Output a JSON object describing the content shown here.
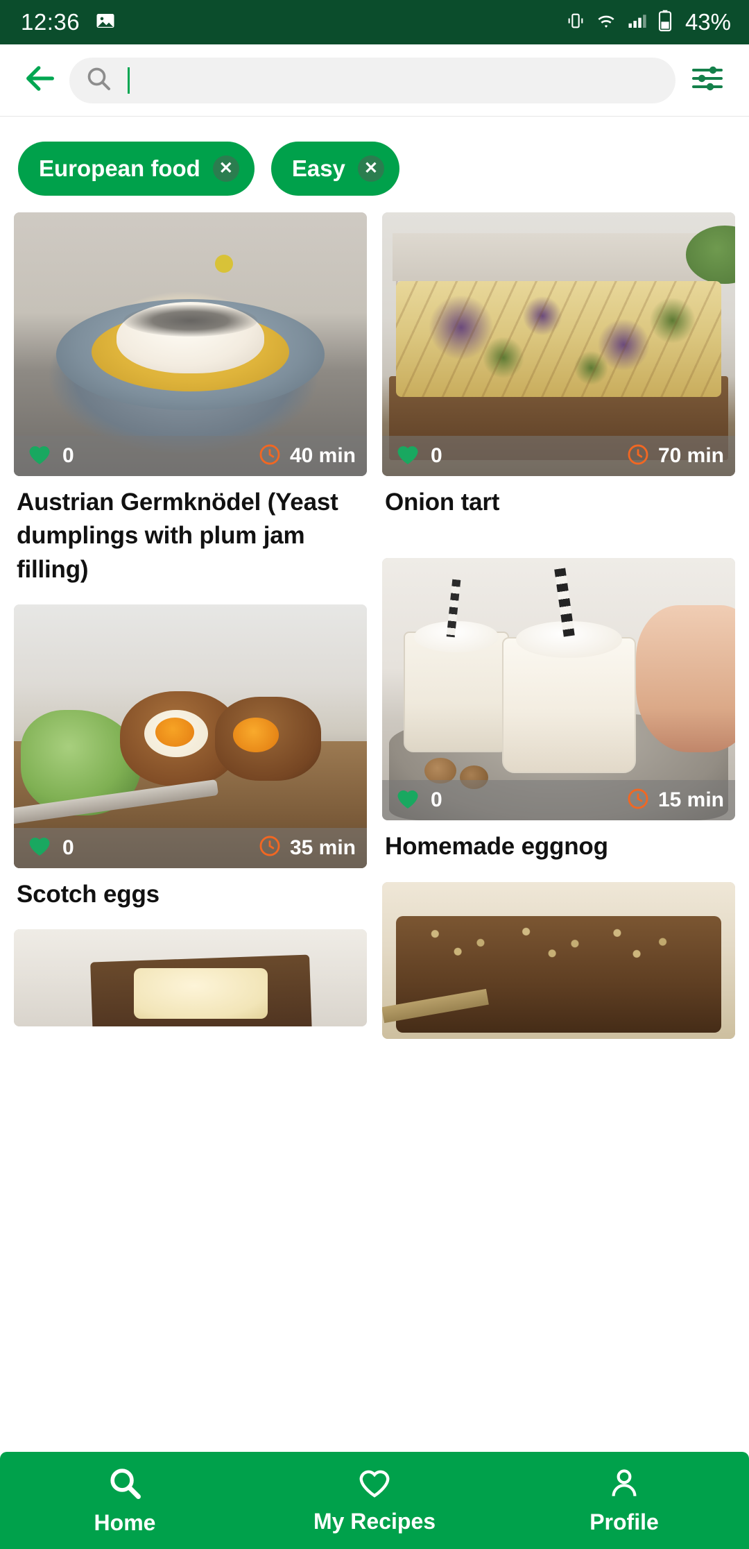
{
  "statusbar": {
    "clock": "12:36",
    "battery": "43%",
    "icons": [
      "image-icon",
      "vibrate-icon",
      "wifi-icon",
      "signal-icon",
      "battery-icon"
    ]
  },
  "search": {
    "back_icon": "arrow-left-icon",
    "search_icon": "search-icon",
    "value": "",
    "placeholder": "",
    "filter_icon": "filter-sliders-icon"
  },
  "filters": [
    {
      "label": "European food",
      "remove_icon": "close-circle-icon"
    },
    {
      "label": "Easy",
      "remove_icon": "close-circle-icon"
    }
  ],
  "colors": {
    "brand_green": "#00a14b",
    "status_bar": "#0b4d2c",
    "time_accent": "#f26722",
    "heart": "#19a860"
  },
  "recipes": {
    "left": [
      {
        "title": "Austrian Germknödel (Yeast dumplings with plum jam filling)",
        "likes": "0",
        "time": "40 min",
        "heart_icon": "heart-filled-icon",
        "clock_icon": "clock-icon",
        "image_name": "germknodel-photo"
      },
      {
        "title": "Scotch eggs",
        "likes": "0",
        "time": "35 min",
        "heart_icon": "heart-filled-icon",
        "clock_icon": "clock-icon",
        "image_name": "scotch-eggs-photo"
      },
      {
        "title": "",
        "likes": "",
        "time": "",
        "heart_icon": "heart-filled-icon",
        "clock_icon": "clock-icon",
        "image_name": "butter-dish-photo"
      }
    ],
    "right": [
      {
        "title": "Onion tart",
        "likes": "0",
        "time": "70 min",
        "heart_icon": "heart-filled-icon",
        "clock_icon": "clock-icon",
        "image_name": "onion-tart-photo"
      },
      {
        "title": "Homemade eggnog",
        "likes": "0",
        "time": "15 min",
        "heart_icon": "heart-filled-icon",
        "clock_icon": "clock-icon",
        "image_name": "eggnog-photo"
      },
      {
        "title": "",
        "likes": "",
        "time": "",
        "heart_icon": "heart-filled-icon",
        "clock_icon": "clock-icon",
        "image_name": "seed-bread-photo"
      }
    ]
  },
  "bottom_nav": [
    {
      "label": "Home",
      "icon": "magnifier-icon",
      "active": true
    },
    {
      "label": "My Recipes",
      "icon": "heart-outline-icon",
      "active": false
    },
    {
      "label": "Profile",
      "icon": "person-icon",
      "active": false
    }
  ]
}
